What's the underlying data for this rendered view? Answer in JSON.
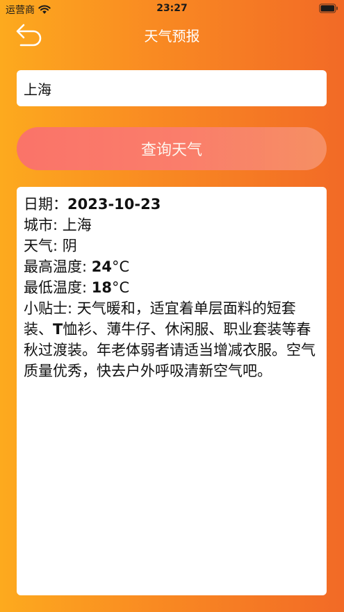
{
  "status_bar": {
    "carrier": "运营商",
    "time": "23:27"
  },
  "nav": {
    "title": "天气预报"
  },
  "search": {
    "city_value": "上海"
  },
  "query_button": {
    "label": "查询天气"
  },
  "result": {
    "date_label": "日期：",
    "date_value": "2023-10-23",
    "city_label": "城市: ",
    "city_value": "上海",
    "weather_label": "天气: ",
    "weather_value": "阴",
    "high_label": "最高温度: ",
    "high_value": "24",
    "high_unit": "°C",
    "low_label": "最低温度: ",
    "low_value": "18",
    "low_unit": "°C",
    "tips_label": "小贴士: ",
    "tips_part1": "天气暖和，适宜着单层面料的短套装、",
    "tips_bold": "T",
    "tips_part2": "恤衫、薄牛仔、休闲服、职业套装等春秋过渡装。年老体弱者请适当增减衣服。空气质量优秀，快去户外呼吸清新空气吧。"
  }
}
